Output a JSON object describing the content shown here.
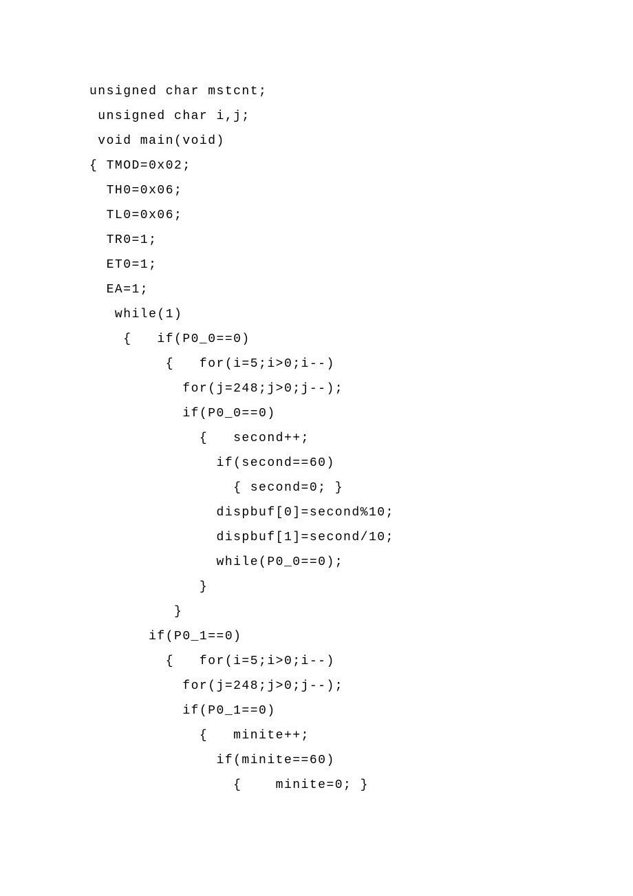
{
  "code": {
    "lines": [
      "unsigned char mstcnt;",
      " unsigned char i,j;",
      " void main(void)",
      "{ TMOD=0x02;",
      "  TH0=0x06;",
      "  TL0=0x06;",
      "  TR0=1;",
      "  ET0=1;",
      "  EA=1;",
      "   while(1)",
      "    {   if(P0_0==0)",
      "         {   for(i=5;i>0;i--)",
      "           for(j=248;j>0;j--);",
      "           if(P0_0==0)",
      "             {   second++;",
      "               if(second==60)",
      "                 { second=0; }",
      "               dispbuf[0]=second%10;",
      "               dispbuf[1]=second/10;",
      "               while(P0_0==0);",
      "             }",
      "          }",
      "       if(P0_1==0)",
      "         {   for(i=5;i>0;i--)",
      "           for(j=248;j>0;j--);",
      "           if(P0_1==0)",
      "             {   minite++;",
      "               if(minite==60)",
      "                 {    minite=0; }"
    ]
  }
}
